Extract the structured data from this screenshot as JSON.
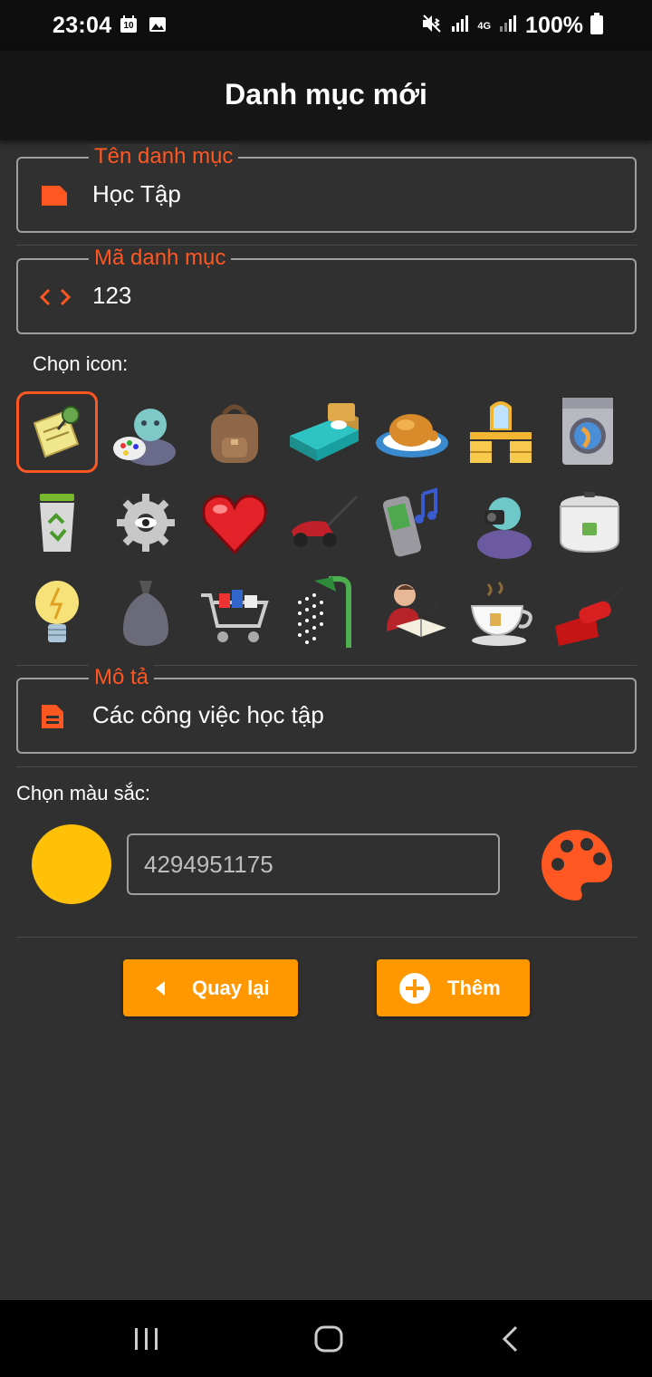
{
  "status_bar": {
    "time": "23:04",
    "calendar_day": "10",
    "network": "4G",
    "battery_percent": "100%"
  },
  "app_bar": {
    "title": "Danh mục mới"
  },
  "form": {
    "name_field": {
      "label": "Tên danh mục",
      "value": "Học Tập",
      "icon": "label-icon"
    },
    "code_field": {
      "label": "Mã danh mục",
      "value": "123",
      "icon": "code-icon"
    },
    "icon_picker": {
      "label": "Chọn icon:",
      "selected_index": 0,
      "icons": [
        "sticky-note-pin-icon",
        "painter-palette-icon",
        "backpack-icon",
        "bed-icon",
        "roast-chicken-icon",
        "vanity-dresser-icon",
        "washing-machine-icon",
        "recycle-bin-icon",
        "gear-icon",
        "heart-icon",
        "lawn-mower-icon",
        "mp3-phone-icon",
        "photographer-icon",
        "rice-cooker-icon",
        "light-bulb-icon",
        "garbage-bag-icon",
        "shopping-cart-icon",
        "shower-icon",
        "reader-icon",
        "tea-cup-icon",
        "paint-roller-icon"
      ]
    },
    "description_field": {
      "label": "Mô tả",
      "value": "Các công việc học tập",
      "icon": "description-icon"
    },
    "color_picker": {
      "label": "Chọn màu sắc:",
      "color": "#ffc107",
      "value": "4294951175"
    }
  },
  "actions": {
    "back_label": "Quay lại",
    "add_label": "Thêm"
  },
  "colors": {
    "accent": "#ff5722",
    "button": "#ff9800",
    "background": "#303030"
  }
}
